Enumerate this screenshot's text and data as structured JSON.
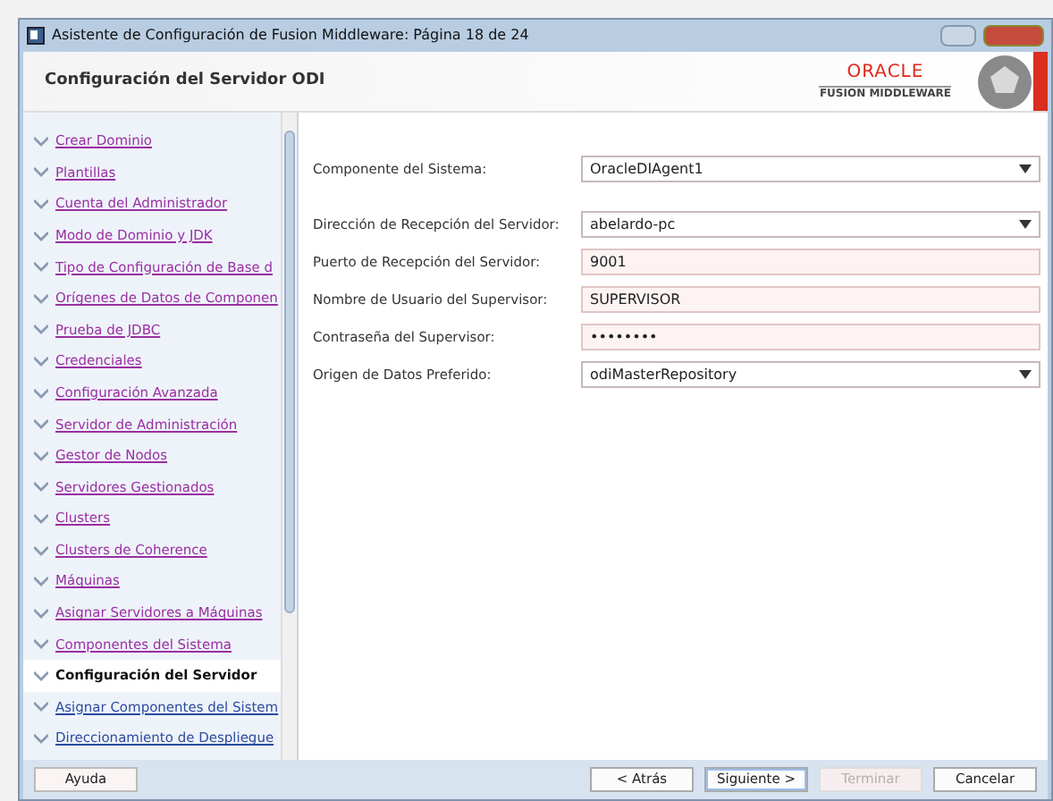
{
  "window": {
    "title": "Asistente de Configuración de Fusion Middleware: Página 18 de 24"
  },
  "header": {
    "title": "Configuración del Servidor ODI",
    "logo": {
      "brand": "ORACLE",
      "product": "FUSION MIDDLEWARE"
    }
  },
  "steps": [
    {
      "label": "Crear Dominio",
      "visited": true,
      "selected": false
    },
    {
      "label": "Plantillas",
      "visited": true,
      "selected": false
    },
    {
      "label": "Cuenta del Administrador",
      "visited": true,
      "selected": false
    },
    {
      "label": "Modo de Dominio y JDK",
      "visited": true,
      "selected": false
    },
    {
      "label": "Tipo de Configuración de Base d",
      "visited": true,
      "selected": false
    },
    {
      "label": "Orígenes de Datos de Componen",
      "visited": true,
      "selected": false
    },
    {
      "label": "Prueba de JDBC",
      "visited": true,
      "selected": false
    },
    {
      "label": "Credenciales",
      "visited": true,
      "selected": false
    },
    {
      "label": "Configuración Avanzada",
      "visited": true,
      "selected": false
    },
    {
      "label": "Servidor de Administración",
      "visited": true,
      "selected": false
    },
    {
      "label": "Gestor de Nodos",
      "visited": true,
      "selected": false
    },
    {
      "label": "Servidores Gestionados",
      "visited": true,
      "selected": false
    },
    {
      "label": "Clusters",
      "visited": true,
      "selected": false
    },
    {
      "label": "Clusters de Coherence",
      "visited": true,
      "selected": false
    },
    {
      "label": "Máquinas",
      "visited": true,
      "selected": false
    },
    {
      "label": "Asignar Servidores a Máquinas",
      "visited": true,
      "selected": false
    },
    {
      "label": "Componentes del Sistema",
      "visited": true,
      "selected": false
    },
    {
      "label": "Configuración del Servidor",
      "selected": true
    },
    {
      "label": "Asignar Componentes del Sistem",
      "visited": false,
      "selected": false
    },
    {
      "label": "Direccionamiento de Despliegue",
      "visited": false,
      "selected": false
    }
  ],
  "form": [
    {
      "kind": "dropdown",
      "label": "Componente del Sistema:",
      "value": "OracleDIAgent1"
    },
    {
      "kind": "dropdown",
      "label": "Dirección de Recepción del Servidor:",
      "value": "abelardo-pc"
    },
    {
      "kind": "text",
      "label": "Puerto de Recepción del Servidor:",
      "value": "9001"
    },
    {
      "kind": "text",
      "label": "Nombre de Usuario del Supervisor:",
      "value": "SUPERVISOR"
    },
    {
      "kind": "password",
      "label": "Contraseña del Supervisor:",
      "value": "••••••••"
    },
    {
      "kind": "dropdown",
      "label": "Origen de Datos Preferido:",
      "value": "odiMasterRepository"
    }
  ],
  "help_button": "Ayuda",
  "buttons": [
    {
      "label": "< Atrás",
      "disabled": false,
      "default": false
    },
    {
      "label": "Siguiente >",
      "disabled": false,
      "default": true
    },
    {
      "label": "Terminar",
      "disabled": true,
      "default": false
    },
    {
      "label": "Cancelar",
      "disabled": false,
      "default": false
    }
  ]
}
